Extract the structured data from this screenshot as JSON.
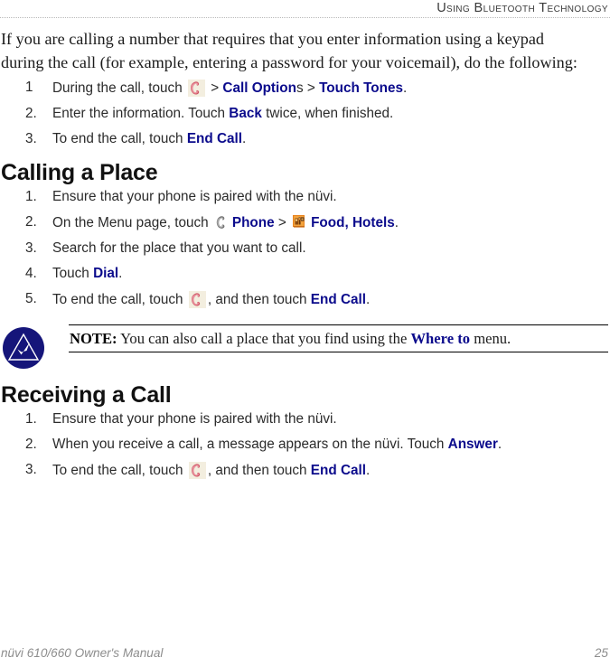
{
  "header": {
    "title": "Using Bluetooth Technology"
  },
  "intro": {
    "paragraph": "If you are calling a number that requires that you enter information using a keypad during the call (for example, entering a password for your voicemail), do the following:"
  },
  "touch_tones_steps": [
    {
      "number": "1",
      "text_before_icon": "During the call, touch ",
      "icon": "phone-handset-red-icon",
      "sep1": " > ",
      "ui1": "Call Option",
      "tail1": "s",
      "sep2": " > ",
      "ui2": "Touch Tones",
      "tail2": "."
    },
    {
      "number": "2.",
      "text_before_ui": "Enter the information. Touch ",
      "ui": "Back",
      "text_after_ui": " twice, when finished."
    },
    {
      "number": "3.",
      "text_before_ui": "To end the call, touch ",
      "ui": "End Call",
      "text_after_ui": "."
    }
  ],
  "calling_place": {
    "heading": "Calling a Place",
    "steps": [
      {
        "number": "1.",
        "text": "Ensure that your phone is paired with the nüvi."
      },
      {
        "number": "2.",
        "text_before_icon": "On the Menu page, touch ",
        "icon1": "phone-handset-gray-icon",
        "ui1": "Phone",
        "sep": " > ",
        "icon2": "food-hotels-icon",
        "ui2": "Food, Hotels",
        "tail": "."
      },
      {
        "number": "3.",
        "text": "Search for the place that you want to call."
      },
      {
        "number": "4.",
        "text_before_ui": "Touch ",
        "ui": "Dial",
        "text_after_ui": "."
      },
      {
        "number": "5.",
        "text_before_icon": "To end the call, touch ",
        "icon": "phone-handset-red-icon",
        "text_after_icon": ", and then touch ",
        "ui": "End Call",
        "tail": "."
      }
    ]
  },
  "note": {
    "icon": "garmin-note-triangle-check-icon",
    "label": "NOTE:",
    "text_before_ui": " You can also call a place that you find using the ",
    "ui": "Where to",
    "text_after_ui": " menu."
  },
  "receiving_call": {
    "heading": "Receiving a Call",
    "steps": [
      {
        "number": "1.",
        "text": "Ensure that your phone is paired with the nüvi."
      },
      {
        "number": "2.",
        "text_before_ui": "When you receive a call, a message appears on the nüvi. Touch ",
        "ui": "Answer",
        "text_after_ui": "."
      },
      {
        "number": "3.",
        "text_before_icon": "To end the call, touch ",
        "icon": "phone-handset-red-icon",
        "text_after_icon": ", and then touch ",
        "ui": "End Call",
        "tail": "."
      }
    ]
  },
  "footer": {
    "manual_title": "nüvi 610/660 Owner's Manual",
    "page_number": "25"
  },
  "colors": {
    "ui_reference": "#0b0b8c",
    "note_icon": "#1a1a7a",
    "footer_text": "#8d8d8d",
    "header_text": "#3a3a3a"
  }
}
